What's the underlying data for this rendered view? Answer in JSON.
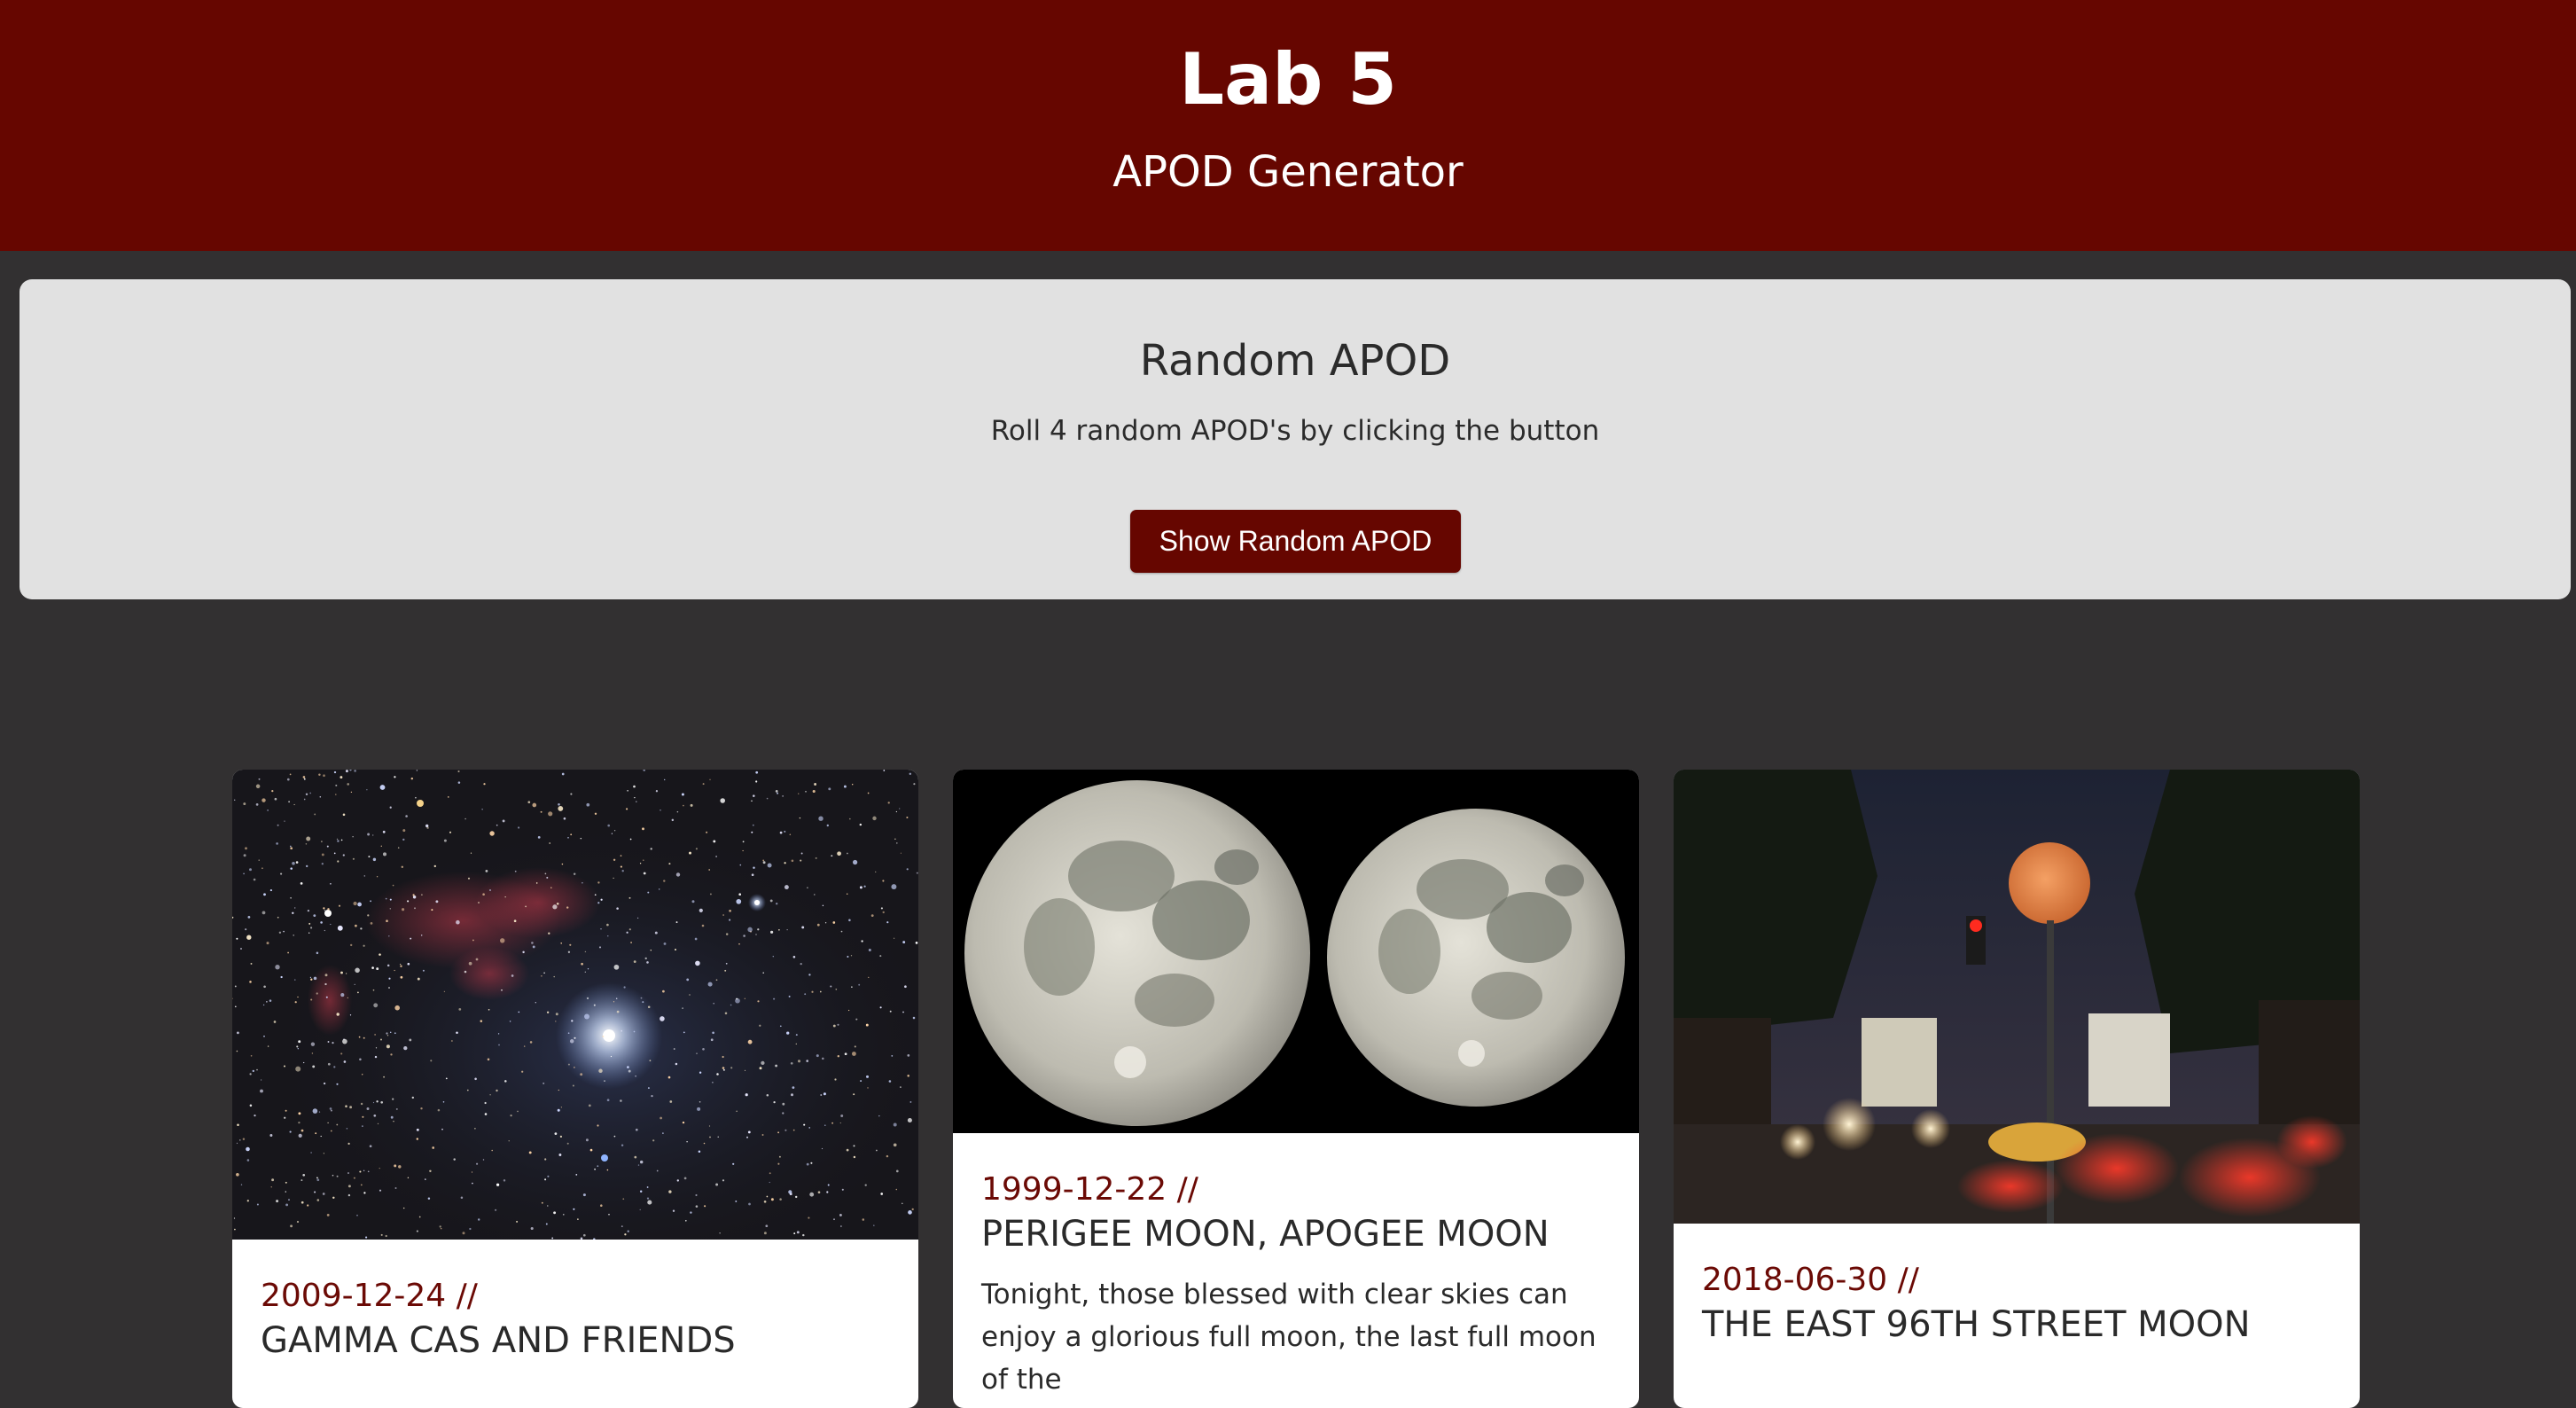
{
  "header": {
    "title": "Lab 5",
    "subtitle": "APOD Generator"
  },
  "random_panel": {
    "heading": "Random APOD",
    "description": "Roll 4 random APOD's by clicking the button",
    "button_label": "Show Random APOD"
  },
  "cards": [
    {
      "date": "2009-12-24 //",
      "title": "GAMMA CAS AND FRIENDS",
      "image": "star field with red nebula"
    },
    {
      "date": "1999-12-22 //",
      "title": "PERIGEE MOON, APOGEE MOON",
      "text": "Tonight, those blessed with clear skies can enjoy a glorious full moon, the last full moon of the",
      "image": "two full moons side by side"
    },
    {
      "date": "2018-06-30 //",
      "title": "THE EAST 96TH STREET MOON",
      "image": "orange moon over city street at night"
    }
  ]
}
